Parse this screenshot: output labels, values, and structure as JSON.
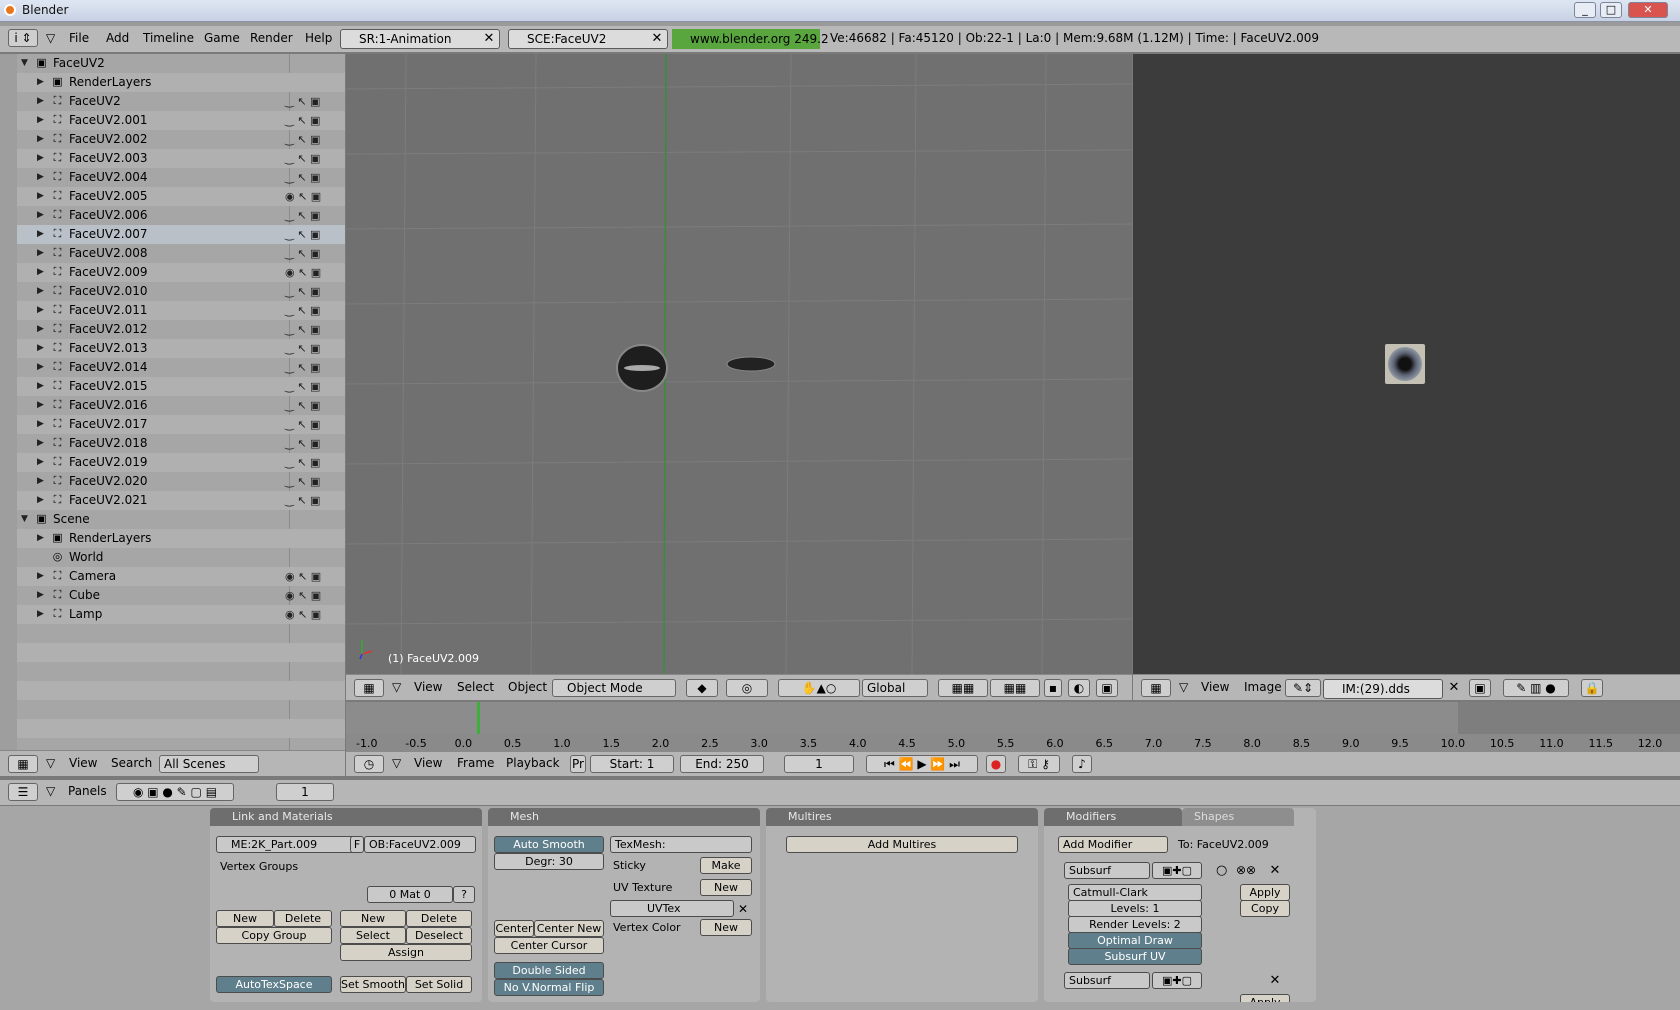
{
  "window": {
    "title": "Blender"
  },
  "menu": {
    "items": [
      "File",
      "Add",
      "Timeline",
      "Game",
      "Render",
      "Help"
    ],
    "screen": "SR:1-Animation",
    "scene": "SCE:FaceUV2",
    "site": "www.blender.org 249.2",
    "stats": "Ve:46682 | Fa:45120 | Ob:22-1 | La:0  | Mem:9.68M (1.12M)  | Time: | FaceUV2.009"
  },
  "outliner": {
    "rows": [
      "FaceUV2",
      "RenderLayers",
      "FaceUV2",
      "FaceUV2.001",
      "FaceUV2.002",
      "FaceUV2.003",
      "FaceUV2.004",
      "FaceUV2.005",
      "FaceUV2.006",
      "FaceUV2.007",
      "FaceUV2.008",
      "FaceUV2.009",
      "FaceUV2.010",
      "FaceUV2.011",
      "FaceUV2.012",
      "FaceUV2.013",
      "FaceUV2.014",
      "FaceUV2.015",
      "FaceUV2.016",
      "FaceUV2.017",
      "FaceUV2.018",
      "FaceUV2.019",
      "FaceUV2.020",
      "FaceUV2.021",
      "Scene",
      "RenderLayers",
      "World",
      "Camera",
      "Cube",
      "Lamp"
    ],
    "header": {
      "view": "View",
      "search": "Search",
      "scope": "All Scenes"
    }
  },
  "viewport3d": {
    "object_label": "(1) FaceUV2.009",
    "header": {
      "view": "View",
      "select": "Select",
      "object": "Object",
      "mode": "Object Mode",
      "orientation": "Global"
    }
  },
  "image_editor": {
    "header": {
      "view": "View",
      "image": "Image",
      "image_name": "IM:(29).dds"
    }
  },
  "timeline": {
    "ticks": [
      "-1.0",
      "-0.5",
      "0.0",
      "0.5",
      "1.0",
      "1.5",
      "2.0",
      "2.5",
      "3.0",
      "3.5",
      "4.0",
      "4.5",
      "5.0",
      "5.5",
      "6.0",
      "6.5",
      "7.0",
      "7.5",
      "8.0",
      "8.5",
      "9.0",
      "9.5",
      "10.0",
      "10.5",
      "11.0",
      "11.5",
      "12.0"
    ],
    "header": {
      "view": "View",
      "frame": "Frame",
      "playback": "Playback",
      "pr": "Pr",
      "start": "Start: 1",
      "end": "End: 250",
      "current": "1"
    }
  },
  "buttons": {
    "header": {
      "panels": "Panels",
      "frame": "1"
    },
    "link": {
      "title": "Link and Materials",
      "mesh": "ME:2K_Part.009",
      "f": "F",
      "ob": "OB:FaceUV2.009",
      "vgroups": "Vertex Groups",
      "mat": "0 Mat 0",
      "q": "?",
      "new": "New",
      "delete": "Delete",
      "copy_group": "Copy Group",
      "new2": "New",
      "delete2": "Delete",
      "select": "Select",
      "deselect": "Deselect",
      "assign": "Assign",
      "autotex": "AutoTexSpace",
      "set_smooth": "Set Smooth",
      "set_solid": "Set Solid"
    },
    "mesh": {
      "title": "Mesh",
      "auto_smooth": "Auto Smooth",
      "degr": "Degr: 30",
      "texmesh": "TexMesh:",
      "sticky": "Sticky",
      "make": "Make",
      "uv_texture": "UV Texture",
      "new": "New",
      "uvtex": "UVTex",
      "vertex_color": "Vertex Color",
      "new2": "New",
      "center": "Center",
      "center_new": "Center New",
      "center_cursor": "Center Cursor",
      "double_sided": "Double Sided",
      "no_vnormal": "No V.Normal Flip"
    },
    "multires": {
      "title": "Multires",
      "add": "Add Multires"
    },
    "modifiers": {
      "tab1": "Modifiers",
      "tab2": "Shapes",
      "add": "Add Modifier",
      "to": "To: FaceUV2.009",
      "name": "Subsurf",
      "type": "Catmull-Clark",
      "levels": "Levels: 1",
      "render_levels": "Render Levels: 2",
      "optimal": "Optimal Draw",
      "subsurf_uv": "Subsurf UV",
      "apply": "Apply",
      "copy": "Copy",
      "name2": "Subsurf",
      "apply2": "Apply"
    }
  }
}
